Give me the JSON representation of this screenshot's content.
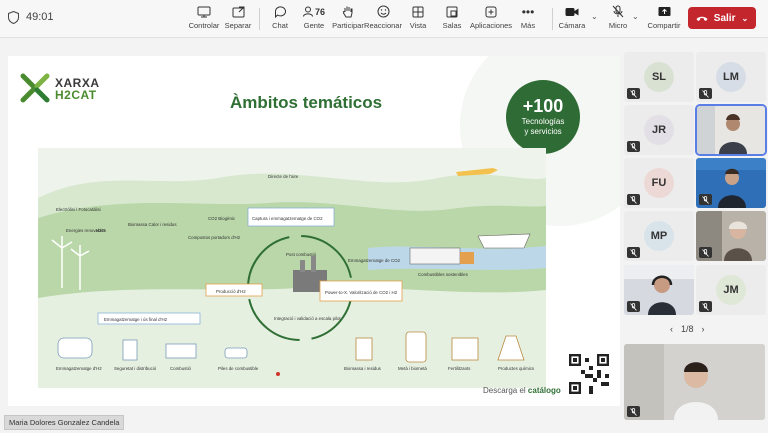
{
  "meeting": {
    "timer": "49:01"
  },
  "toolbar": {
    "controlar": "Controlar",
    "separar": "Separar",
    "chat": "Chat",
    "gente": "Gente",
    "gente_count": "76",
    "participar": "Participar",
    "reaccionar": "Reaccionar",
    "vista": "Vista",
    "salas": "Salas",
    "aplicaciones": "Aplicaciones",
    "mas": "Más",
    "camara": "Cámara",
    "micro": "Micro",
    "compartir": "Compartir",
    "salir": "Salir"
  },
  "slide": {
    "logo_line1": "XARXA",
    "logo_line2": "H2CAT",
    "title": "Àmbitos temáticos",
    "badge_number": "+100",
    "badge_line1": "Tecnologías",
    "badge_line2": "y servicios",
    "descarga_prefix": "Descarga el",
    "descarga_link": "catálogo",
    "labels": {
      "electrolisi": "Electròlisi / Fotocatàlisi",
      "energies": "Energies renovables",
      "h2o": "H2O",
      "biomassa_calor": "Biomassa Calor i residus",
      "co2_biogenic": "CO2 Biogènic",
      "compostos": "Compostos portadors d'H2",
      "directe_aire": "Directe de l'aire",
      "captura": "Captura i emmagatzematge de CO2",
      "post_combustio": "Post combustió",
      "emmag_co2": "Emmagatzematge de CO2",
      "combustibles_sost": "Combustibles sostenibles",
      "produccio": "Producció d'H2",
      "power_to_x": "Power-to-X. Valorització de CO2 i H2",
      "integracio": "Integració i validació a escala pilot",
      "emmag_h2": "Emmagatzematge i ús final d'H2",
      "emmag_bottom": "Emmagatzematge d'H2",
      "seguretat": "Seguretat i distribució",
      "combustio": "Combustió",
      "piles": "Piles de combustible",
      "biomassa_res": "Biomassa i residus",
      "meta": "Metà i biometà",
      "fertilitzants": "Fertilitzants",
      "productes": "Productes químics"
    }
  },
  "presenter": {
    "name": "Maria Dolores Gonzalez Candela"
  },
  "participants": [
    {
      "initials": "SL",
      "color": "#d9e1d3"
    },
    {
      "initials": "LM",
      "color": "#d6dde6"
    },
    {
      "initials": "JR",
      "color": "#e3dfe6"
    },
    {
      "initials": "FU",
      "color": "#ecd9d6"
    },
    {
      "initials": "MP",
      "color": "#d8e3ea"
    },
    {
      "initials": "JM",
      "color": "#dfe8d6"
    }
  ],
  "pager": {
    "label": "1/8"
  },
  "colors": {
    "accent_green": "#2f6f34",
    "leave_red": "#c4262e",
    "active_outline": "#5b7de6"
  }
}
